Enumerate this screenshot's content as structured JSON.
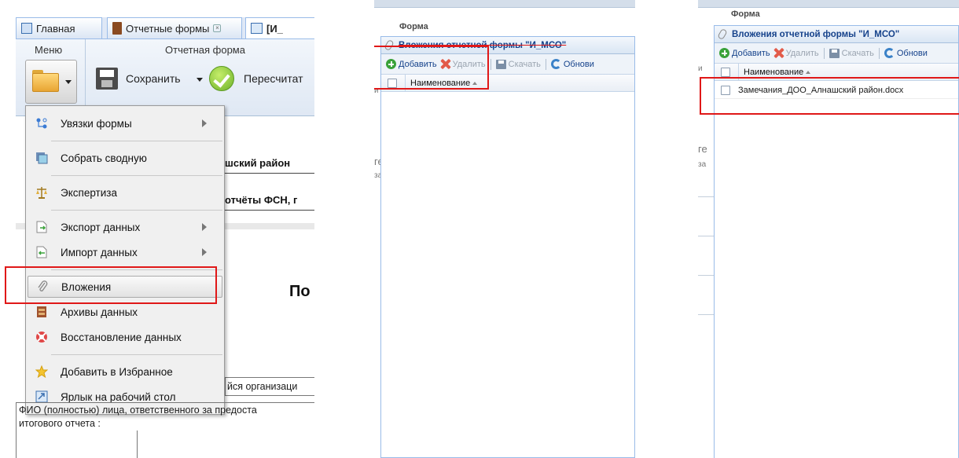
{
  "panel1": {
    "tabs": [
      {
        "label": "Главная",
        "icon": "home-icon"
      },
      {
        "label": "Отчетные формы",
        "icon": "book-icon"
      },
      {
        "label": "[И_",
        "icon": "form-icon"
      }
    ],
    "ribbon": {
      "menu_group_title": "Меню",
      "form_group_title": "Отчетная форма",
      "save_label": "Сохранить",
      "recalc_label": "Пересчитат"
    },
    "behind_texts": {
      "district": "шский район",
      "reports": "отчёты ФСН, г",
      "big_letters": "По",
      "org": "йся организаци",
      "fio_line1": "ФИО (полностью) лица, ответственного за предоста",
      "fio_line2": "итогового отчета :"
    },
    "menu_items": [
      {
        "label": "Увязки формы",
        "icon": "links-icon",
        "submenu": true
      },
      {
        "label": "Собрать сводную",
        "icon": "collect-icon",
        "submenu": false
      },
      {
        "label": "Экспертиза",
        "icon": "scales-icon",
        "submenu": false
      },
      {
        "label": "Экспорт данных",
        "icon": "export-icon",
        "submenu": true
      },
      {
        "label": "Импорт данных",
        "icon": "import-icon",
        "submenu": true
      },
      {
        "label": "Вложения",
        "icon": "paperclip-icon",
        "submenu": false
      },
      {
        "label": "Архивы данных",
        "icon": "archive-icon",
        "submenu": false
      },
      {
        "label": "Восстановление данных",
        "icon": "lifebuoy-icon",
        "submenu": false
      },
      {
        "label": "Добавить в Избранное",
        "icon": "star-icon",
        "submenu": false
      },
      {
        "label": "Ярлык на рабочий стол",
        "icon": "shortcut-icon",
        "submenu": false
      }
    ]
  },
  "panel2": {
    "group_title": "Форма",
    "window_title": "Вложения отчетной формы \"И_МСО\"",
    "toolbar": {
      "add": "Добавить",
      "delete": "Удалить",
      "download": "Скачать",
      "refresh": "Обнови"
    },
    "column_header": "Наименование"
  },
  "panel3": {
    "group_title": "Форма",
    "window_title": "Вложения отчетной формы \"И_МСО\"",
    "toolbar": {
      "add": "Добавить",
      "delete": "Удалить",
      "download": "Скачать",
      "refresh": "Обнови"
    },
    "column_header": "Наименование",
    "rows": [
      {
        "name": "Замечания_ДОО_Алнашский район.docx"
      }
    ]
  },
  "colors": {
    "highlight_border": "#e01818",
    "header_text": "#15428b",
    "panel_border": "#99bbe8"
  }
}
